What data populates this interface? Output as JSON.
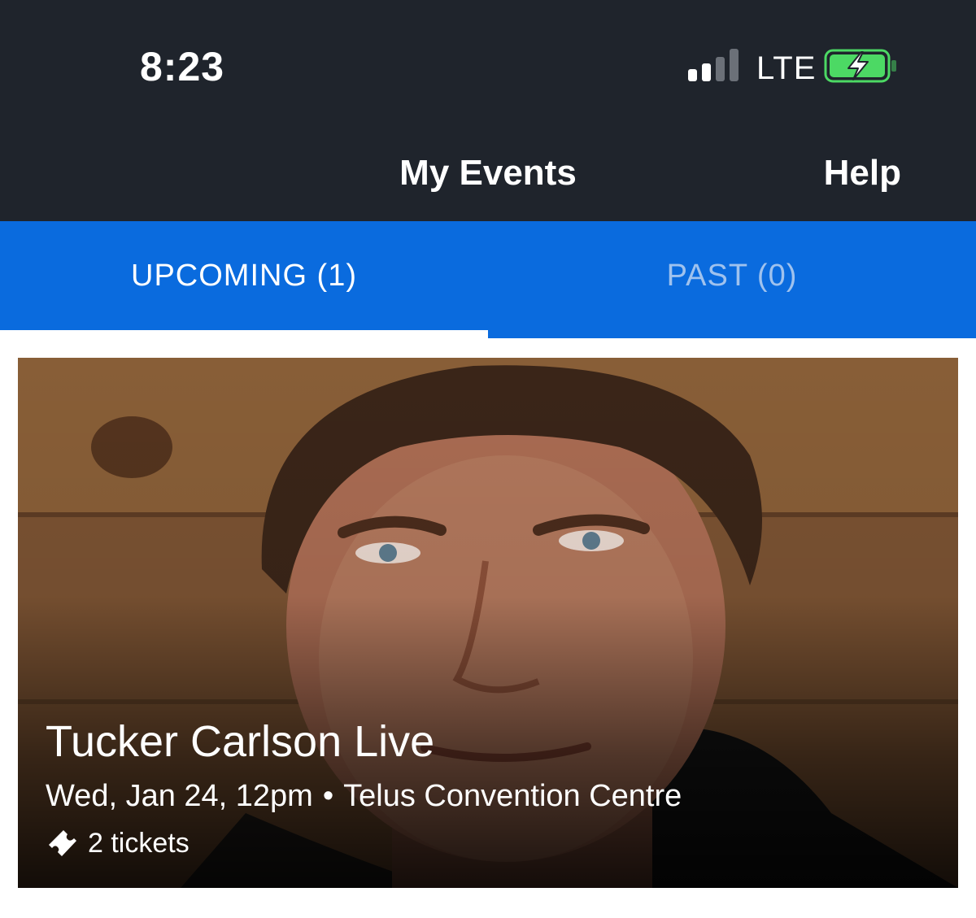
{
  "status_bar": {
    "time": "8:23",
    "network": "LTE",
    "signal_bars_active": 2,
    "signal_bars_total": 4,
    "battery_charging": true,
    "battery_color": "#4cd964"
  },
  "header": {
    "title": "My Events",
    "help_label": "Help",
    "background_color": "#1f242c"
  },
  "tabs": [
    {
      "label": "UPCOMING (1)",
      "active": true
    },
    {
      "label": "PAST (0)",
      "active": false
    }
  ],
  "accent_color": "#0a6bde",
  "event": {
    "title": "Tucker Carlson Live",
    "date": "Wed, Jan 24, 12pm",
    "separator": "•",
    "venue": "Telus Convention Centre",
    "tickets": "2 tickets",
    "ticket_icon": "ticket-icon",
    "image": "headshot-photo"
  }
}
